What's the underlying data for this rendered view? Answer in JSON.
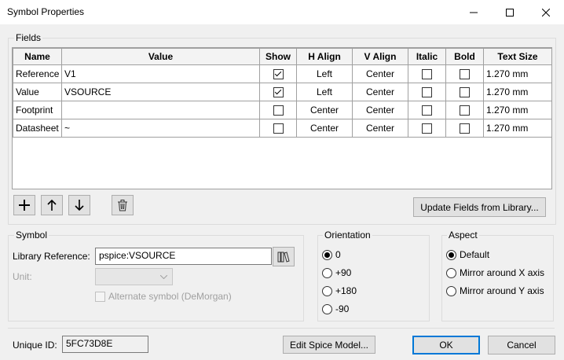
{
  "window": {
    "title": "Symbol Properties"
  },
  "fields": {
    "group_label": "Fields",
    "columns": [
      "Name",
      "Value",
      "Show",
      "H Align",
      "V Align",
      "Italic",
      "Bold",
      "Text Size"
    ],
    "rows": [
      {
        "name": "Reference",
        "value": "V1",
        "show": true,
        "halign": "Left",
        "valign": "Center",
        "italic": false,
        "bold": false,
        "size": "1.270 mm"
      },
      {
        "name": "Value",
        "value": "VSOURCE",
        "show": true,
        "halign": "Left",
        "valign": "Center",
        "italic": false,
        "bold": false,
        "size": "1.270 mm"
      },
      {
        "name": "Footprint",
        "value": "",
        "show": false,
        "halign": "Center",
        "valign": "Center",
        "italic": false,
        "bold": false,
        "size": "1.270 mm"
      },
      {
        "name": "Datasheet",
        "value": "~",
        "show": false,
        "halign": "Center",
        "valign": "Center",
        "italic": false,
        "bold": false,
        "size": "1.270 mm"
      }
    ],
    "update_button": "Update Fields from Library..."
  },
  "symbol": {
    "group_label": "Symbol",
    "lib_ref_label": "Library Reference:",
    "lib_ref_value": "pspice:VSOURCE",
    "unit_label": "Unit:",
    "alternate_label": "Alternate symbol (DeMorgan)"
  },
  "orientation": {
    "group_label": "Orientation",
    "options": [
      "0",
      "+90",
      "+180",
      "-90"
    ],
    "selected": 0
  },
  "aspect": {
    "group_label": "Aspect",
    "options": [
      "Default",
      "Mirror around X axis",
      "Mirror around Y axis"
    ],
    "selected": 0
  },
  "footer": {
    "unique_id_label": "Unique ID:",
    "unique_id_value": "5FC73D8E",
    "spice_button": "Edit Spice Model...",
    "ok_button": "OK",
    "cancel_button": "Cancel"
  },
  "colors": {
    "accent": "#0078d7"
  }
}
